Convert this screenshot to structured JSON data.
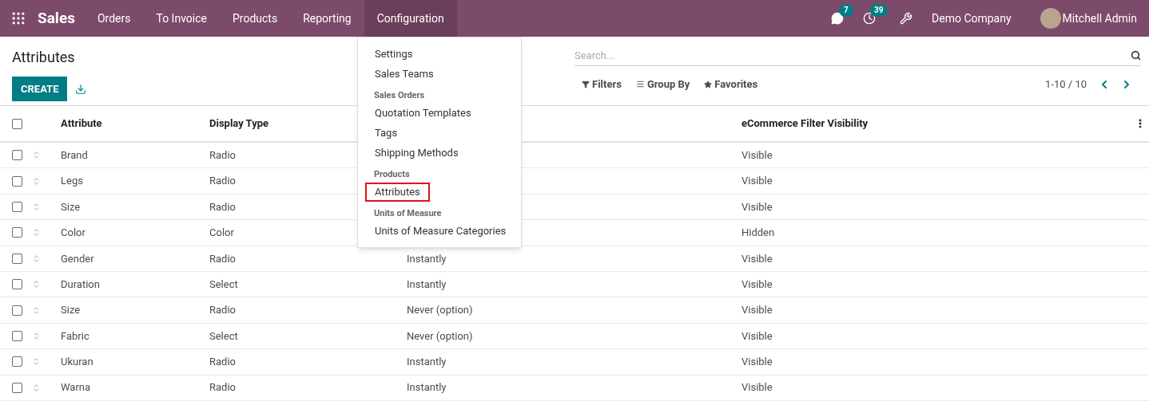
{
  "top_bar": {
    "app_name": "Sales",
    "menus": [
      {
        "label": "Orders",
        "selected": false
      },
      {
        "label": "To Invoice",
        "selected": false
      },
      {
        "label": "Products",
        "selected": false
      },
      {
        "label": "Reporting",
        "selected": false
      },
      {
        "label": "Configuration",
        "selected": true
      }
    ],
    "messages_count": "7",
    "activities_count": "39",
    "company": "Demo Company",
    "user": "Mitchell Admin"
  },
  "dropdown": {
    "items": [
      {
        "kind": "item",
        "label": "Settings",
        "highlighted": false
      },
      {
        "kind": "item",
        "label": "Sales Teams",
        "highlighted": false
      },
      {
        "kind": "header",
        "label": "Sales Orders"
      },
      {
        "kind": "item",
        "label": "Quotation Templates",
        "highlighted": false
      },
      {
        "kind": "item",
        "label": "Tags",
        "highlighted": false
      },
      {
        "kind": "item",
        "label": "Shipping Methods",
        "highlighted": false
      },
      {
        "kind": "header",
        "label": "Products"
      },
      {
        "kind": "item",
        "label": "Attributes",
        "highlighted": true
      },
      {
        "kind": "header",
        "label": "Units of Measure"
      },
      {
        "kind": "item",
        "label": "Units of Measure Categories",
        "highlighted": false
      }
    ]
  },
  "control_panel": {
    "title": "Attributes",
    "create_button": "CREATE",
    "search": {
      "placeholder": "Search..."
    },
    "filters": "Filters",
    "group_by": "Group By",
    "favorites": "Favorites",
    "pager": "1-10 / 10"
  },
  "table": {
    "all_checked": false,
    "columns": [
      "Attribute",
      "Display Type",
      "eCommerce Filter Visibility"
    ],
    "rows": [
      {
        "attribute": "Brand",
        "display_type": "Radio",
        "visibility": "Visible",
        "checked": false
      },
      {
        "attribute": "Legs",
        "display_type": "Radio",
        "visibility": "Visible",
        "checked": false
      },
      {
        "attribute": "Size",
        "display_type": "Radio",
        "visibility": "Visible",
        "checked": false
      },
      {
        "attribute": "Color",
        "display_type": "Color",
        "visibility": "Hidden",
        "checked": false
      },
      {
        "attribute": "Gender",
        "display_type": "Radio",
        "column_3": "Instantly",
        "visibility": "Visible",
        "checked": false
      },
      {
        "attribute": "Duration",
        "display_type": "Select",
        "column_3": "Instantly",
        "visibility": "Visible",
        "checked": false
      },
      {
        "attribute": "Size",
        "display_type": "Radio",
        "column_3": "Never (option)",
        "visibility": "Visible",
        "checked": false
      },
      {
        "attribute": "Fabric",
        "display_type": "Select",
        "column_3": "Never (option)",
        "visibility": "Visible",
        "checked": false
      },
      {
        "attribute": "Ukuran",
        "display_type": "Radio",
        "column_3": "Instantly",
        "visibility": "Visible",
        "checked": false
      },
      {
        "attribute": "Warna",
        "display_type": "Radio",
        "column_3": "Instantly",
        "visibility": "Visible",
        "checked": false
      }
    ]
  }
}
